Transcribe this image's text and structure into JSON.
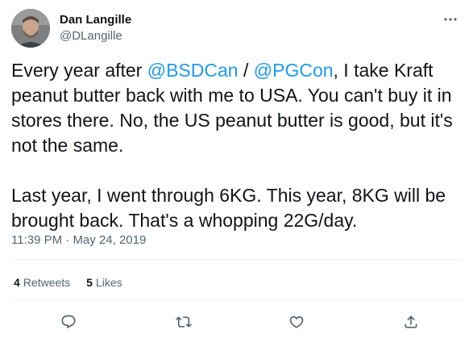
{
  "author": {
    "display_name": "Dan Langille",
    "handle": "@DLangille"
  },
  "tweet": {
    "line1_pre": "Every year after ",
    "mention_bsdcan": "@BSDCan",
    "line1_sep": " / ",
    "mention_pgcon": "@PGCon",
    "line1_post": ", I take Kraft peanut butter back with me to USA. You can't buy it in stores there. No, the US peanut butter is good, but it's not the same.",
    "paragraph2": "Last year, I went through 6KG.  This year, 8KG will be brought back.  That's a whopping 22G/day."
  },
  "meta": {
    "time": "11:39 PM",
    "separator": " · ",
    "date": "May 24, 2019"
  },
  "stats": {
    "retweets_count": "4",
    "retweets_label": "Retweets",
    "likes_count": "5",
    "likes_label": "Likes"
  },
  "icons": {
    "more": "more-horizontal-icon",
    "reply": "reply-icon",
    "retweet": "retweet-icon",
    "like": "heart-icon",
    "share": "share-icon"
  },
  "colors": {
    "link": "#1d9bf0",
    "secondary_text": "#536471",
    "primary_text": "#0f1419",
    "divider": "#eff3f4"
  }
}
